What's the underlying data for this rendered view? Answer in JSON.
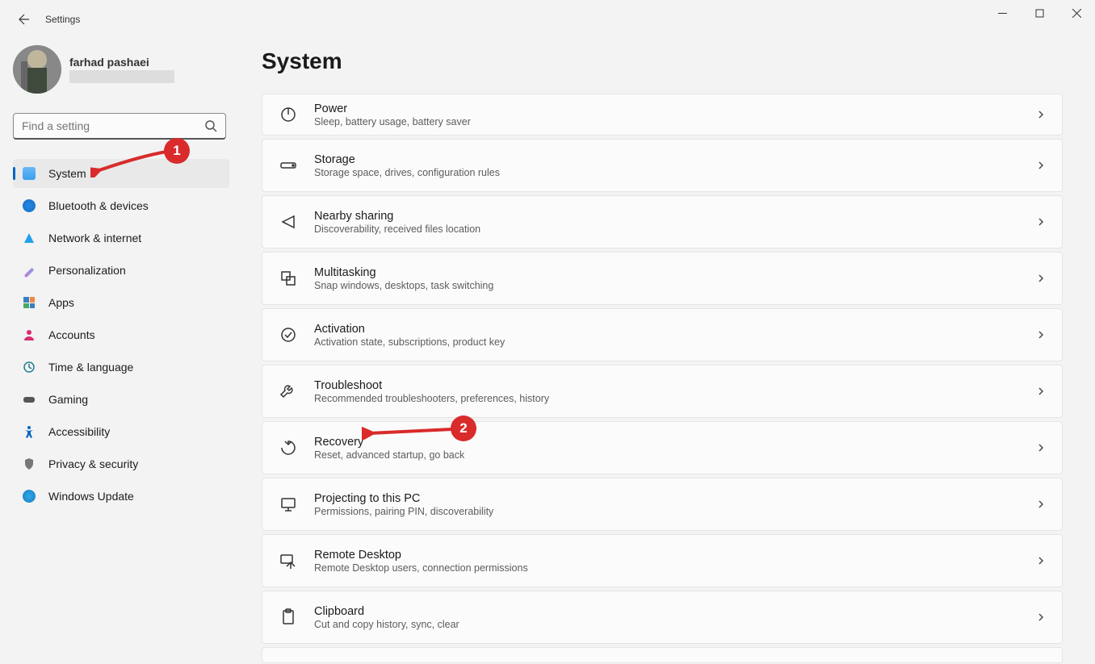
{
  "window": {
    "title": "Settings"
  },
  "profile": {
    "name": "farhad pashaei"
  },
  "search": {
    "placeholder": "Find a setting"
  },
  "page": {
    "title": "System"
  },
  "nav": [
    {
      "label": "System",
      "active": true
    },
    {
      "label": "Bluetooth & devices"
    },
    {
      "label": "Network & internet"
    },
    {
      "label": "Personalization"
    },
    {
      "label": "Apps"
    },
    {
      "label": "Accounts"
    },
    {
      "label": "Time & language"
    },
    {
      "label": "Gaming"
    },
    {
      "label": "Accessibility"
    },
    {
      "label": "Privacy & security"
    },
    {
      "label": "Windows Update"
    }
  ],
  "settings": [
    {
      "title": "Power",
      "sub": "Sleep, battery usage, battery saver"
    },
    {
      "title": "Storage",
      "sub": "Storage space, drives, configuration rules"
    },
    {
      "title": "Nearby sharing",
      "sub": "Discoverability, received files location"
    },
    {
      "title": "Multitasking",
      "sub": "Snap windows, desktops, task switching"
    },
    {
      "title": "Activation",
      "sub": "Activation state, subscriptions, product key"
    },
    {
      "title": "Troubleshoot",
      "sub": "Recommended troubleshooters, preferences, history"
    },
    {
      "title": "Recovery",
      "sub": "Reset, advanced startup, go back"
    },
    {
      "title": "Projecting to this PC",
      "sub": "Permissions, pairing PIN, discoverability"
    },
    {
      "title": "Remote Desktop",
      "sub": "Remote Desktop users, connection permissions"
    },
    {
      "title": "Clipboard",
      "sub": "Cut and copy history, sync, clear"
    }
  ],
  "annotations": {
    "badge1": "1",
    "badge2": "2"
  }
}
